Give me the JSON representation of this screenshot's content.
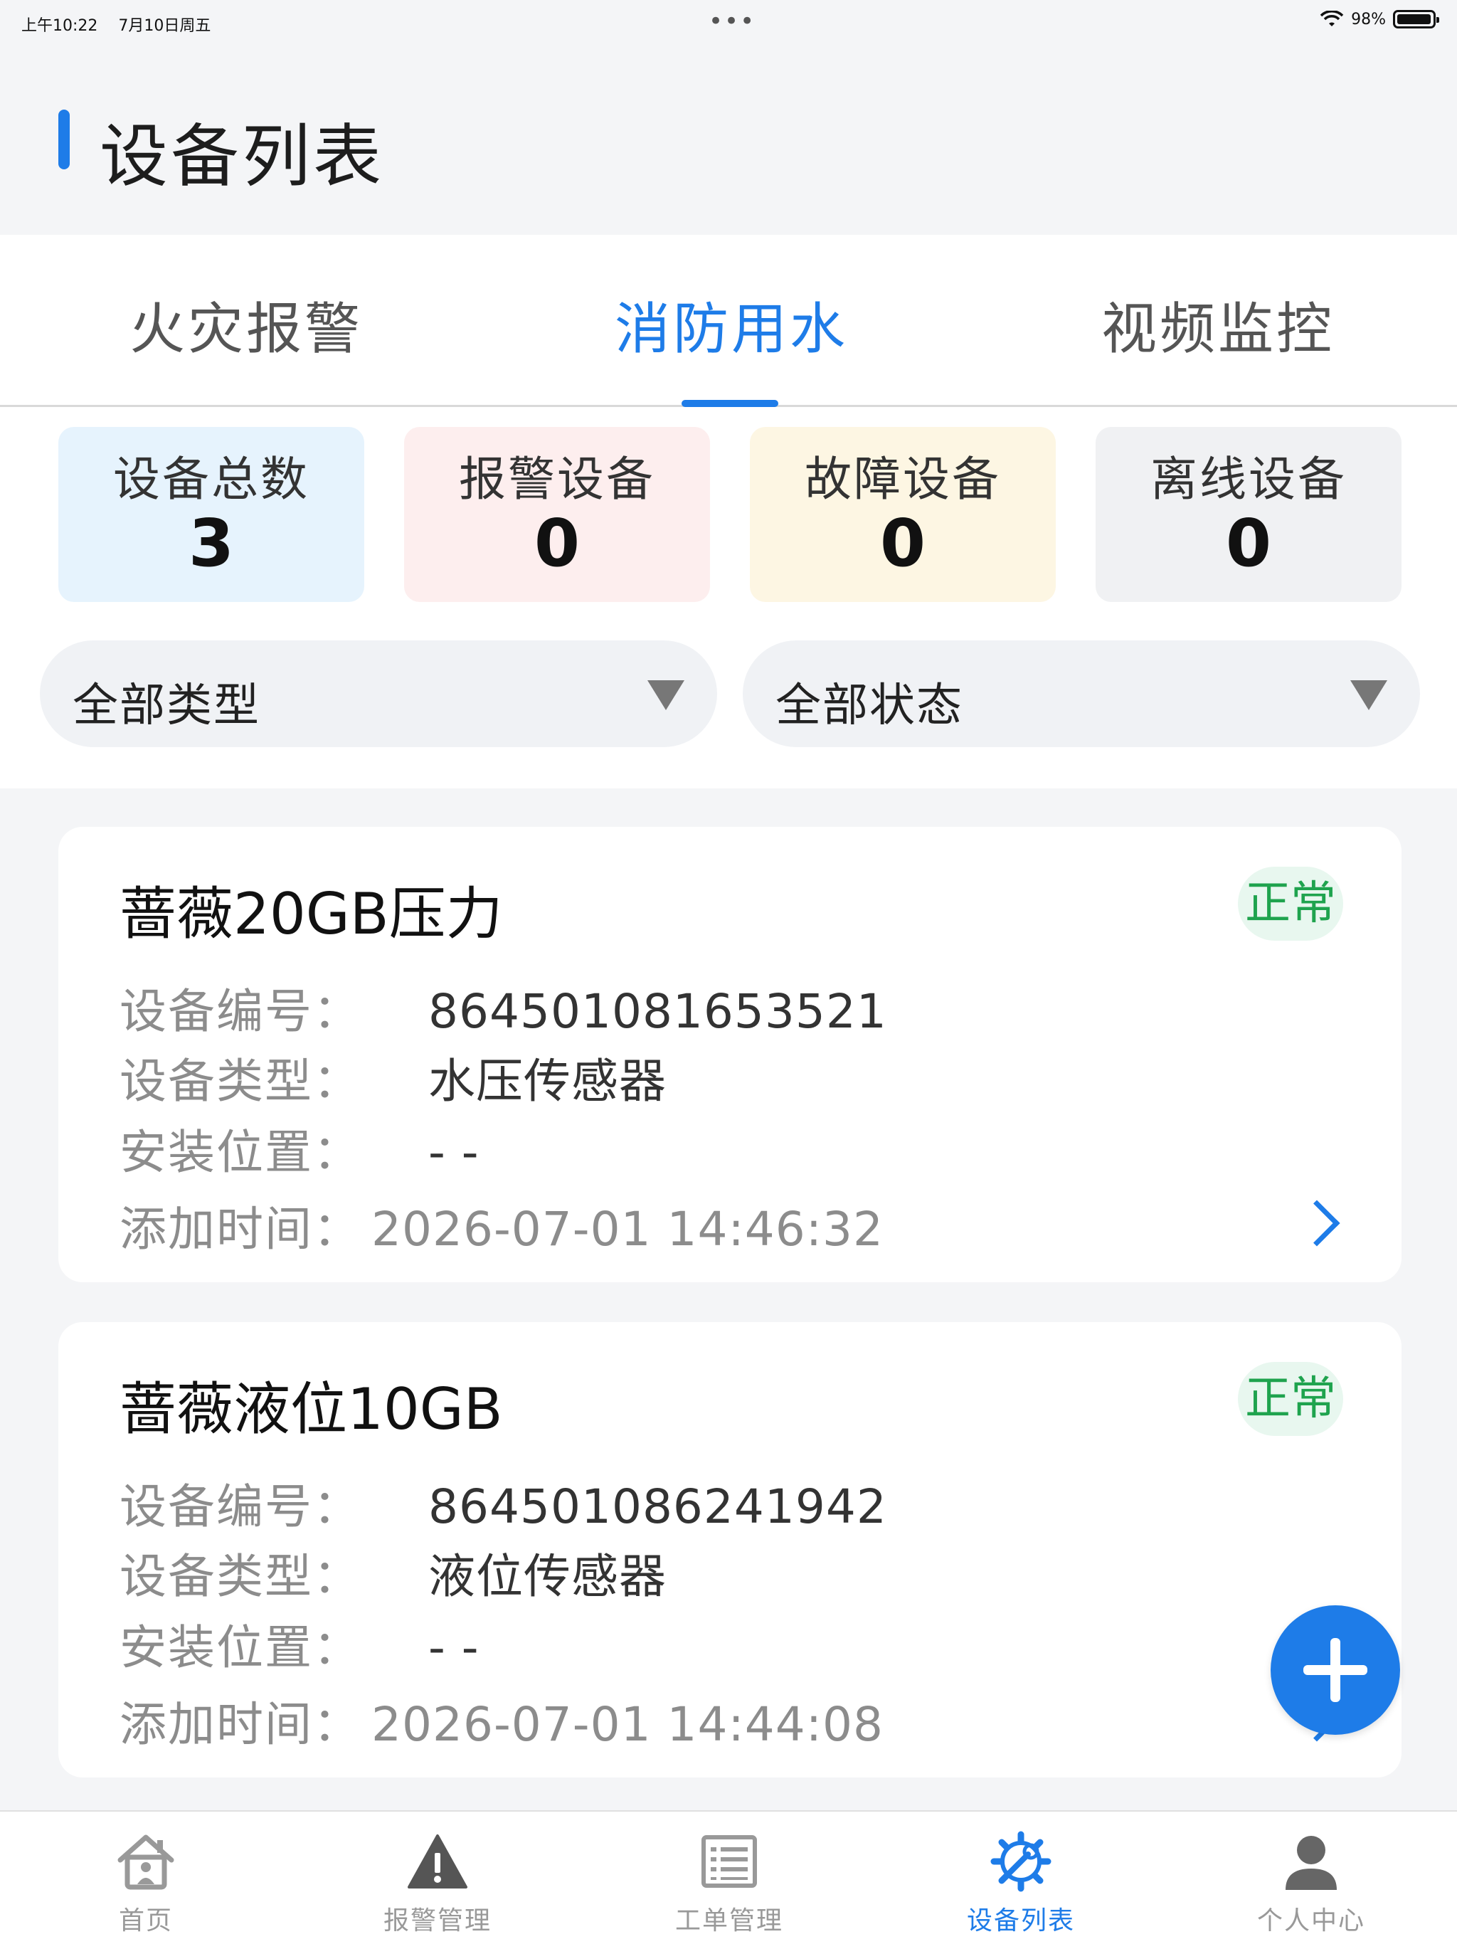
{
  "status_bar": {
    "time": "上午10:22",
    "date": "7月10日周五",
    "dots": "•••",
    "battery": "98%",
    "battery_level": 0.98
  },
  "header": {
    "title": "设备列表"
  },
  "tabs": [
    {
      "label": "火灾报警",
      "active": false
    },
    {
      "label": "消防用水",
      "active": true
    },
    {
      "label": "视频监控",
      "active": false
    }
  ],
  "stats": [
    {
      "label": "设备总数",
      "value": "3",
      "bg": "#e6f3fd"
    },
    {
      "label": "报警设备",
      "value": "0",
      "bg": "#fdeeee"
    },
    {
      "label": "故障设备",
      "value": "0",
      "bg": "#fdf6e3"
    },
    {
      "label": "离线设备",
      "value": "0",
      "bg": "#f0f1f3"
    }
  ],
  "filters": {
    "type": "全部类型",
    "status": "全部状态"
  },
  "field_labels": {
    "code": "设备编号：",
    "type": "设备类型：",
    "location": "安装位置：",
    "added": "添加时间："
  },
  "devices": [
    {
      "name": "蔷薇20GB压力",
      "status": "正常",
      "code": "864501081653521",
      "type": "水压传感器",
      "location": "- -",
      "added": "2026-07-01 14:46:32"
    },
    {
      "name": "蔷薇液位10GB",
      "status": "正常",
      "code": "864501086241942",
      "type": "液位传感器",
      "location": "- -",
      "added": "2026-07-01 14:44:08"
    }
  ],
  "bottom_nav": [
    {
      "label": "首页",
      "icon": "home-icon",
      "active": false
    },
    {
      "label": "报警管理",
      "icon": "warning-icon",
      "active": false
    },
    {
      "label": "工单管理",
      "icon": "list-icon",
      "active": false
    },
    {
      "label": "设备列表",
      "icon": "device-settings-icon",
      "active": true
    },
    {
      "label": "个人中心",
      "icon": "user-icon",
      "active": false
    }
  ],
  "colors": {
    "accent": "#1e7ce8",
    "normal_status": "#1fa34e",
    "page_bg": "#f4f5f7"
  }
}
